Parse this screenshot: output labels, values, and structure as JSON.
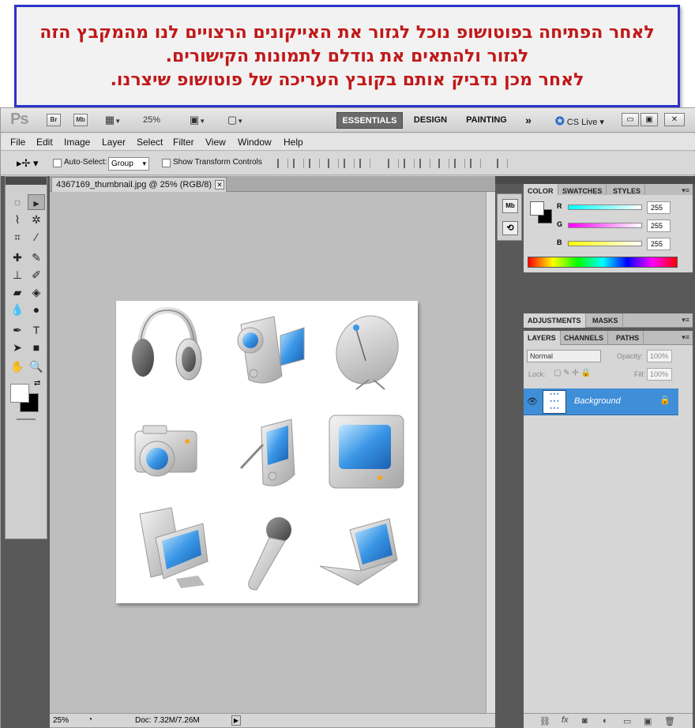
{
  "instruction": {
    "line1": "לאחר הפתיחה בפוטושופ נוכל לגזור את האייקונים הרצויים לנו מהמקבץ הזה",
    "line2": "לגזור ולהתאים את גודלם לתמונות הקישורים.",
    "line3": "לאחר מכן נדביק אותם בקובץ העריכה של פוטושופ שיצרנו."
  },
  "appbar": {
    "logo": "Ps",
    "bridge": "Br",
    "minibridge": "Mb",
    "zoom": "25%",
    "workspaces": [
      "ESSENTIALS",
      "DESIGN",
      "PAINTING"
    ],
    "more": "»",
    "cslive": "CS Live"
  },
  "menu": [
    "File",
    "Edit",
    "Image",
    "Layer",
    "Select",
    "Filter",
    "View",
    "Window",
    "Help"
  ],
  "options": {
    "auto_select_label": "Auto-Select:",
    "auto_select_value": "Group",
    "transform_label": "Show Transform Controls"
  },
  "document": {
    "tab_title": "4367169_thumbnail.jpg @ 25% (RGB/8)",
    "status_zoom": "25%",
    "status_doc": "Doc: 7.32M/7.26M",
    "icons": [
      "headphones",
      "video-camera",
      "satellite-dish",
      "photo-camera",
      "pda",
      "crt-monitor",
      "desktop-computer",
      "microphone",
      "laptop"
    ]
  },
  "color_panel": {
    "tabs": [
      "COLOR",
      "SWATCHES",
      "STYLES"
    ],
    "r_label": "R",
    "g_label": "G",
    "b_label": "B",
    "r_value": "255",
    "g_value": "255",
    "b_value": "255",
    "foreground": "#ffffff",
    "background": "#000000"
  },
  "adjustments_panel": {
    "tabs": [
      "ADJUSTMENTS",
      "MASKS"
    ]
  },
  "layers_panel": {
    "tabs": [
      "LAYERS",
      "CHANNELS",
      "PATHS"
    ],
    "blend_mode": "Normal",
    "opacity_label": "Opacity:",
    "opacity_value": "100%",
    "lock_label": "Lock:",
    "fill_label": "Fill:",
    "fill_value": "100%",
    "layer_name": "Background"
  },
  "colors": {
    "instruction_text": "#c01818",
    "instruction_border": "#2b33c9",
    "layer_selected": "#3f8ed8"
  }
}
